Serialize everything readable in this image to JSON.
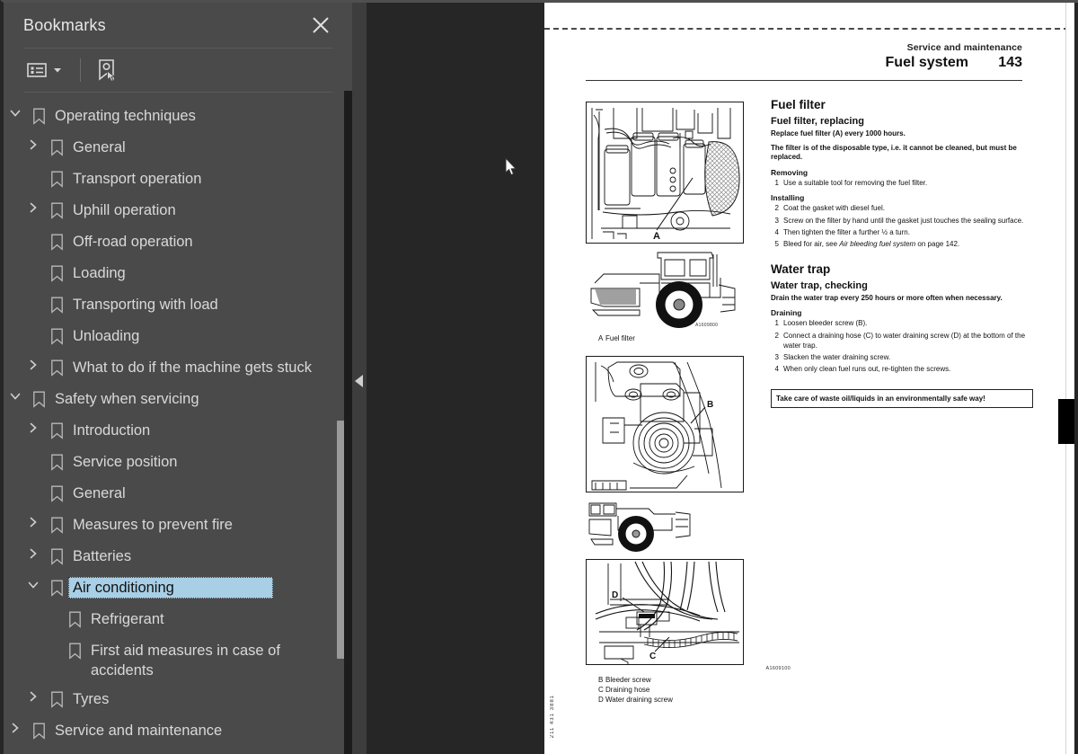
{
  "sidebar": {
    "title": "Bookmarks",
    "close_icon": "close-icon",
    "toolbar": {
      "list_options_icon": "list-options-icon",
      "dropdown_icon": "chevron-down-icon",
      "new_bookmark_icon": "bookmark-pointer-icon"
    },
    "items": [
      {
        "label": "Operating techniques",
        "level": 0,
        "state": "expanded",
        "selected": false
      },
      {
        "label": "General",
        "level": 1,
        "state": "collapsed",
        "selected": false
      },
      {
        "label": "Transport operation",
        "level": 1,
        "state": "leaf",
        "selected": false
      },
      {
        "label": "Uphill operation",
        "level": 1,
        "state": "collapsed",
        "selected": false
      },
      {
        "label": "Off-road operation",
        "level": 1,
        "state": "leaf",
        "selected": false
      },
      {
        "label": "Loading",
        "level": 1,
        "state": "leaf",
        "selected": false
      },
      {
        "label": "Transporting with load",
        "level": 1,
        "state": "leaf",
        "selected": false
      },
      {
        "label": "Unloading",
        "level": 1,
        "state": "leaf",
        "selected": false
      },
      {
        "label": "What to do if the machine gets stuck",
        "level": 1,
        "state": "collapsed",
        "selected": false
      },
      {
        "label": "Safety when servicing",
        "level": 0,
        "state": "expanded",
        "selected": false
      },
      {
        "label": "Introduction",
        "level": 1,
        "state": "collapsed",
        "selected": false
      },
      {
        "label": "Service position",
        "level": 1,
        "state": "leaf",
        "selected": false
      },
      {
        "label": "General",
        "level": 1,
        "state": "leaf",
        "selected": false
      },
      {
        "label": "Measures to prevent fire",
        "level": 1,
        "state": "collapsed",
        "selected": false
      },
      {
        "label": "Batteries",
        "level": 1,
        "state": "collapsed",
        "selected": false
      },
      {
        "label": "Air conditioning",
        "level": 1,
        "state": "expanded",
        "selected": true
      },
      {
        "label": "Refrigerant",
        "level": 2,
        "state": "leaf",
        "selected": false
      },
      {
        "label": "First aid measures in case of accidents",
        "level": 2,
        "state": "leaf",
        "selected": false
      },
      {
        "label": "Tyres",
        "level": 1,
        "state": "collapsed",
        "selected": false
      },
      {
        "label": "Service and maintenance",
        "level": 0,
        "state": "collapsed",
        "selected": false
      }
    ],
    "colors": {
      "panel_bg": "#4a4a4a",
      "selection": "#a8cfe6",
      "text": "#d9d9d9"
    }
  },
  "splitter": {
    "collapse_icon": "collapse-left-arrow-icon"
  },
  "document": {
    "header": {
      "chapter": "Service and maintenance",
      "section": "Fuel system",
      "page_number": "143"
    },
    "sections": [
      {
        "title": "Fuel filter",
        "subtitle": "Fuel filter, replacing",
        "lead": "Replace fuel filter (A) every 1000 hours.",
        "note": "The filter is of the disposable type, i.e. it cannot be cleaned, but must be replaced.",
        "groups": [
          {
            "label": "Removing",
            "steps": [
              {
                "n": "1",
                "text": "Use a suitable tool for removing the fuel filter."
              }
            ]
          },
          {
            "label": "Installing",
            "steps": [
              {
                "n": "2",
                "text": "Coat the gasket with diesel fuel."
              },
              {
                "n": "3",
                "text": "Screw on the filter by hand until the gasket just touches the sealing surface."
              },
              {
                "n": "4",
                "text": "Then tighten the filter a further ½ a turn."
              },
              {
                "n": "5",
                "text": "Bleed for air, see Air bleeding fuel system on page 142."
              }
            ]
          }
        ]
      },
      {
        "title": "Water trap",
        "subtitle": "Water trap, checking",
        "lead": "Drain the water trap every 250 hours or more often when necessary.",
        "groups": [
          {
            "label": "Draining",
            "steps": [
              {
                "n": "1",
                "text": "Loosen bleeder screw (B)."
              },
              {
                "n": "2",
                "text": "Connect a draining hose (C) to water draining screw (D) at the bottom of the water trap."
              },
              {
                "n": "3",
                "text": "Slacken the water draining screw."
              },
              {
                "n": "4",
                "text": "When only clean fuel runs out, re-tighten the screws."
              }
            ]
          }
        ]
      }
    ],
    "warning": "Take care of waste oil/liquids in an environmentally safe way!",
    "figures": [
      {
        "id": "A1609800",
        "callout": "A",
        "legend": [
          {
            "key": "A",
            "text": "Fuel filter"
          }
        ]
      },
      {
        "id": "",
        "callout": "B",
        "legend": []
      },
      {
        "id": "A1609100",
        "callouts": [
          "D",
          "C"
        ],
        "legend": [
          {
            "key": "B",
            "text": "Bleeder screw"
          },
          {
            "key": "C",
            "text": "Draining hose"
          },
          {
            "key": "D",
            "text": "Water draining screw"
          }
        ]
      }
    ],
    "margin_code": "211 431 3881"
  },
  "cursor": {
    "icon": "mouse-pointer-icon"
  }
}
